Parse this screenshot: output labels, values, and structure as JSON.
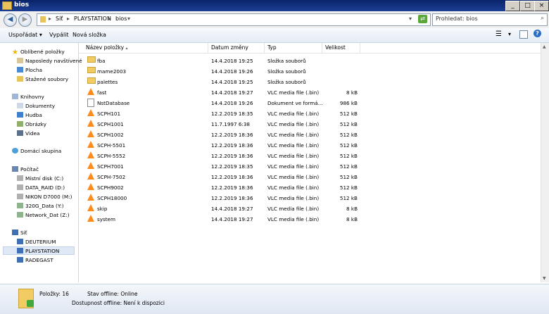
{
  "window": {
    "title": "bios"
  },
  "address": {
    "segments": [
      "Síť",
      "PLAYSTATION",
      "bios"
    ],
    "search_placeholder": "Prohledat: bios"
  },
  "toolbar": {
    "organize": "Uspořádat",
    "burn": "Vypálit",
    "new_folder": "Nová složka"
  },
  "nav": {
    "favorites": {
      "label": "Oblíbené položky",
      "items": [
        "Naposledy navštívené",
        "Plocha",
        "Stažené soubory"
      ]
    },
    "libraries": {
      "label": "Knihovny",
      "items": [
        "Dokumenty",
        "Hudba",
        "Obrázky",
        "Videa"
      ]
    },
    "homegroup": {
      "label": "Domácí skupina"
    },
    "computer": {
      "label": "Počítač",
      "items": [
        "Místní disk (C:)",
        "DATA_RAID (D:)",
        "NIKON D7000 (M:)",
        "320G_Data (Y:)",
        "Network_Dat (Z:)"
      ]
    },
    "network": {
      "label": "Síť",
      "items": [
        "DEUTERIUM",
        "PLAYSTATION",
        "RADEGAST"
      ]
    }
  },
  "columns": {
    "name": "Název položky",
    "date": "Datum změny",
    "type": "Typ",
    "size": "Velikost"
  },
  "files": [
    {
      "name": "fba",
      "date": "14.4.2018 19:25",
      "type": "Složka souborů",
      "size": "",
      "icon": "folder"
    },
    {
      "name": "mame2003",
      "date": "14.4.2018 19:26",
      "type": "Složka souborů",
      "size": "",
      "icon": "folder"
    },
    {
      "name": "palettes",
      "date": "14.4.2018 19:25",
      "type": "Složka souborů",
      "size": "",
      "icon": "folder"
    },
    {
      "name": "fast",
      "date": "14.4.2018 19:27",
      "type": "VLC media file (.bin)",
      "size": "8 kB",
      "icon": "vlc"
    },
    {
      "name": "NstDatabase",
      "date": "14.4.2018 19:26",
      "type": "Dokument ve formá...",
      "size": "986 kB",
      "icon": "doc"
    },
    {
      "name": "SCPH101",
      "date": "12.2.2019 18:35",
      "type": "VLC media file (.bin)",
      "size": "512 kB",
      "icon": "vlc"
    },
    {
      "name": "SCPH1001",
      "date": "11.7.1997 6:38",
      "type": "VLC media file (.bin)",
      "size": "512 kB",
      "icon": "vlc"
    },
    {
      "name": "SCPH1002",
      "date": "12.2.2019 18:36",
      "type": "VLC media file (.bin)",
      "size": "512 kB",
      "icon": "vlc"
    },
    {
      "name": "SCPH-5501",
      "date": "12.2.2019 18:36",
      "type": "VLC media file (.bin)",
      "size": "512 kB",
      "icon": "vlc"
    },
    {
      "name": "SCPH-5552",
      "date": "12.2.2019 18:36",
      "type": "VLC media file (.bin)",
      "size": "512 kB",
      "icon": "vlc"
    },
    {
      "name": "SCPH7001",
      "date": "12.2.2019 18:35",
      "type": "VLC media file (.bin)",
      "size": "512 kB",
      "icon": "vlc"
    },
    {
      "name": "SCPH-7502",
      "date": "12.2.2019 18:36",
      "type": "VLC media file (.bin)",
      "size": "512 kB",
      "icon": "vlc"
    },
    {
      "name": "SCPH9002",
      "date": "12.2.2019 18:36",
      "type": "VLC media file (.bin)",
      "size": "512 kB",
      "icon": "vlc"
    },
    {
      "name": "SCPH18000",
      "date": "12.2.2019 18:36",
      "type": "VLC media file (.bin)",
      "size": "512 kB",
      "icon": "vlc"
    },
    {
      "name": "skip",
      "date": "14.4.2018 19:27",
      "type": "VLC media file (.bin)",
      "size": "8 kB",
      "icon": "vlc"
    },
    {
      "name": "system",
      "date": "14.4.2018 19:27",
      "type": "VLC media file (.bin)",
      "size": "8 kB",
      "icon": "vlc"
    }
  ],
  "status": {
    "count": "Položky: 16",
    "offline_state": "Stav offline: Online",
    "offline_avail": "Dostupnost offline: Není k dispozici"
  }
}
